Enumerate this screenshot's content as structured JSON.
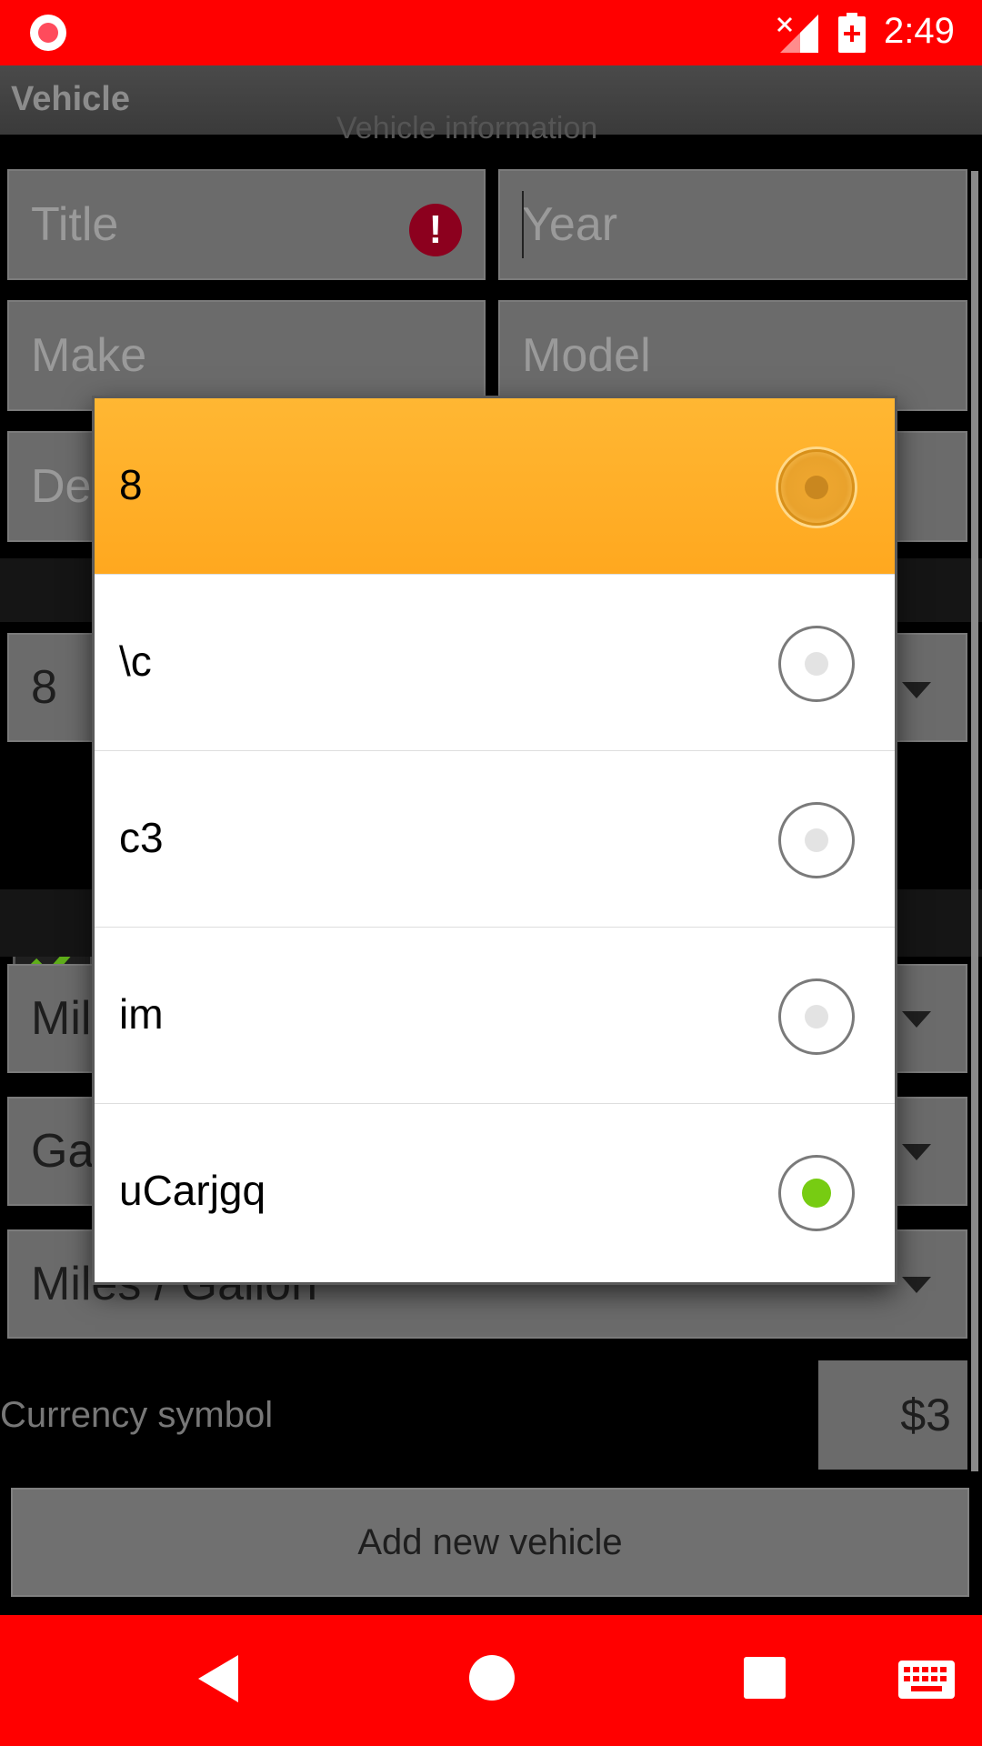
{
  "status_bar": {
    "time": "2:49",
    "icons": [
      "record-icon",
      "no-signal-icon",
      "battery-charging-icon"
    ]
  },
  "action_bar": {
    "title": "Vehicle"
  },
  "form": {
    "section_header": "Vehicle information",
    "title_placeholder": "Title",
    "year_placeholder": "Year",
    "make_placeholder": "Make",
    "model_placeholder": "Model",
    "description_placeholder_partial": "Des",
    "vehicle_type_value": "8",
    "distance_unit_partial": "Mil",
    "volume_unit_partial": "Gal",
    "economy_unit": "Miles / Gallon",
    "currency_label": "Currency symbol",
    "currency_value": "$3",
    "add_button": "Add new vehicle"
  },
  "dialog": {
    "options": [
      {
        "label": "8",
        "highlighted": true,
        "checked": false
      },
      {
        "label": "\\c",
        "highlighted": false,
        "checked": false
      },
      {
        "label": "c3",
        "highlighted": false,
        "checked": false
      },
      {
        "label": "im",
        "highlighted": false,
        "checked": false
      },
      {
        "label": "uCarjgq",
        "highlighted": false,
        "checked": true
      }
    ]
  },
  "nav_bar": {
    "icons": [
      "back-icon",
      "home-icon",
      "recents-icon",
      "keyboard-icon"
    ]
  },
  "colors": {
    "status_bar": "#ff0000",
    "highlight": "#ffb12a",
    "radio_checked": "#77cc12"
  }
}
